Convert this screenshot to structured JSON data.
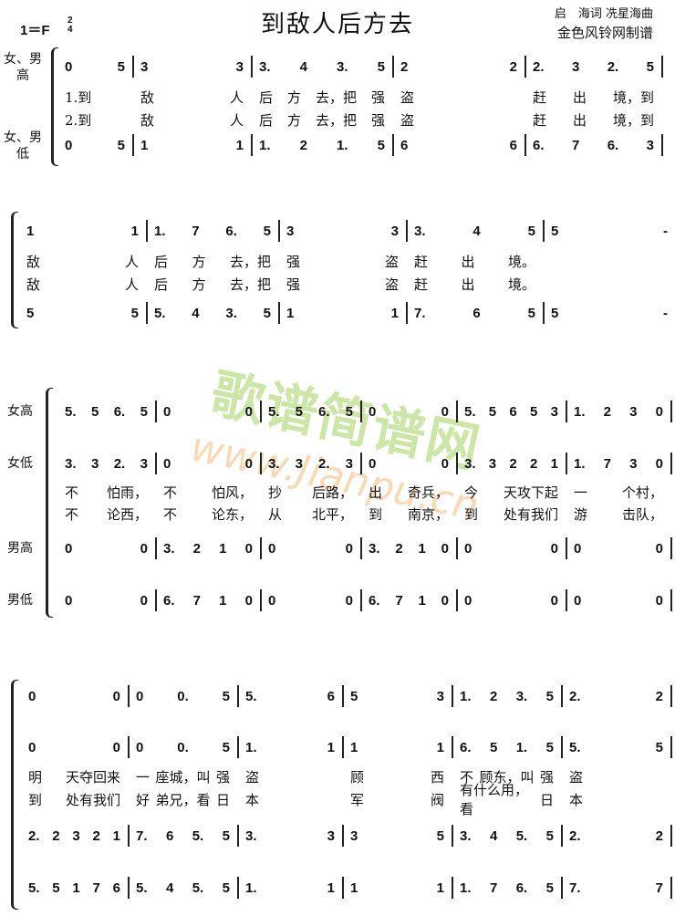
{
  "header": {
    "key": "1＝F",
    "time_top": "2",
    "time_bottom": "4",
    "title": "到敌人后方去",
    "credits": "启　海词  冼星海曲",
    "maker": "金色风铃网制谱"
  },
  "watermark": {
    "line1": "歌谱简谱网",
    "line2": "www.Jianpu.cn"
  },
  "systems": [
    {
      "labels": [
        "女、男\n高",
        "女、男\n低"
      ],
      "rows": [
        {
          "type": "notes",
          "measures": [
            "0 5",
            "3 3",
            "3. 4 3. 5",
            "2 2",
            "2. 3 2. 5"
          ]
        },
        {
          "type": "lyric",
          "measures": [
            "1.到",
            "敌 人",
            "后 方 去，把 强",
            "盗",
            "赶 出 境，到"
          ]
        },
        {
          "type": "lyric",
          "measures": [
            "2.到",
            "敌 人",
            "后 方 去，把 强",
            "盗",
            "赶 出 境，到"
          ]
        },
        {
          "type": "notes",
          "measures": [
            "0 5",
            "1 1",
            "1. 2 1. 5",
            "6 6",
            "6. 7 6. 3"
          ]
        }
      ]
    },
    {
      "labels": [],
      "rows": [
        {
          "type": "notes",
          "measures": [
            "1 1",
            "1. 7 6. 5",
            "3 3",
            "3. 4 5",
            "5 -"
          ]
        },
        {
          "type": "lyric",
          "measures": [
            "敌 人",
            "后 方 去，把",
            "强 盗",
            "赶 出 境。",
            ""
          ]
        },
        {
          "type": "lyric",
          "measures": [
            "敌 人",
            "后 方 去，把",
            "强 盗",
            "赶 出 境。",
            ""
          ]
        },
        {
          "type": "notes",
          "measures": [
            "5 5",
            "5. 4 3. 5",
            "1 1",
            "7. 6 5",
            "5 -"
          ]
        }
      ]
    },
    {
      "labels": [
        "女高",
        "女低",
        "男高",
        "男低"
      ],
      "rows": [
        {
          "type": "notes",
          "measures": [
            "5. 5 6. 5",
            "0 0",
            "5. 5 6. 5",
            "0 0",
            "5. 5 6 5 3",
            "1. 2 3 0"
          ]
        },
        {
          "type": "notes",
          "measures": [
            "3. 3 2. 3",
            "0 0",
            "3. 3 2. 3",
            "0 0",
            "3. 3 2 2 1",
            "1. 7 3 0"
          ]
        },
        {
          "type": "lyric",
          "measures": [
            "不 怕雨，",
            "不 怕风，",
            "抄 后路，",
            "出 奇兵，",
            "今 天攻下起",
            "一 个村，"
          ]
        },
        {
          "type": "lyric",
          "measures": [
            "不 论西，",
            "不 论东，",
            "从 北平，",
            "到 南京，",
            "到 处有我们",
            "游 击队，"
          ]
        },
        {
          "type": "notes",
          "measures": [
            "0 0",
            "3. 2 1 0",
            "0 0",
            "3. 2 1 0",
            "0 0",
            "0 0"
          ]
        },
        {
          "type": "notes",
          "measures": [
            "0 0",
            "6. 7 1 0",
            "0 0",
            "6. 7 1 0",
            "0 0",
            "0 0"
          ]
        }
      ]
    },
    {
      "labels": [],
      "rows": [
        {
          "type": "notes",
          "measures": [
            "0 0",
            "0 0. 5",
            "5. 6",
            "5 3",
            "1. 2 3. 5",
            "2. 2"
          ]
        },
        {
          "type": "notes",
          "measures": [
            "0 0",
            "0 0. 5",
            "1. 1",
            "1 1",
            "6. 5 1. 5",
            "5. 5"
          ]
        },
        {
          "type": "lyric",
          "measures": [
            "明 天夺回来",
            "一 座城，叫 强",
            "盗",
            "顾 西",
            "不 顾东，叫 强",
            "盗"
          ]
        },
        {
          "type": "lyric",
          "measures": [
            "到 处有我们",
            "好 弟兄，看 日",
            "本",
            "军 阀",
            "有什么用，看 日",
            "本"
          ]
        },
        {
          "type": "notes",
          "measures": [
            "2. 2 3 2 1",
            "7. 6 5. 5",
            "3. 3",
            "3 5",
            "3. 4 5. 5",
            "2. 2"
          ]
        },
        {
          "type": "notes",
          "measures": [
            "5. 5 1 7 6",
            "5. 4 5. 5",
            "1. 1",
            "1 1",
            "1. 7 6. 5",
            "7. 7"
          ]
        }
      ]
    }
  ]
}
